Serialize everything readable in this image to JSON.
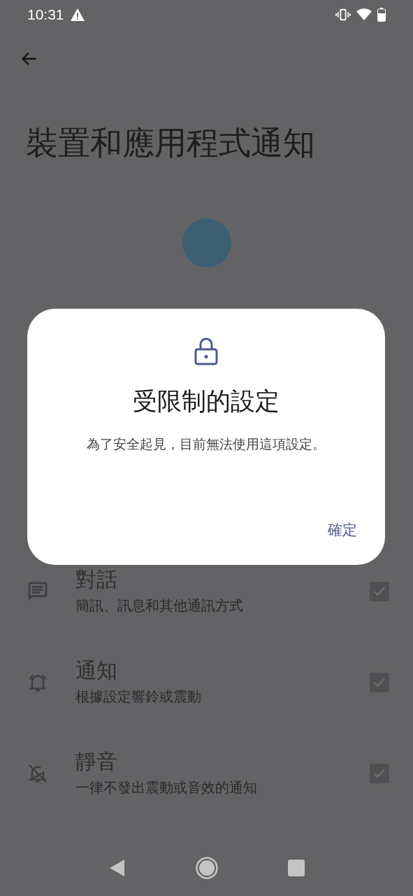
{
  "status_bar": {
    "time": "10:31"
  },
  "page": {
    "title": "裝置和應用程式通知"
  },
  "rows": [
    {
      "title": "對話",
      "subtitle": "簡訊、訊息和其他通訊方式",
      "checked": true
    },
    {
      "title": "通知",
      "subtitle": "根據設定響鈴或震動",
      "checked": true
    },
    {
      "title": "靜音",
      "subtitle": "一律不發出震動或音效的通知",
      "checked": true
    }
  ],
  "dialog": {
    "title": "受限制的設定",
    "message": "為了安全起見，目前無法使用這項設定。",
    "button": "確定"
  }
}
